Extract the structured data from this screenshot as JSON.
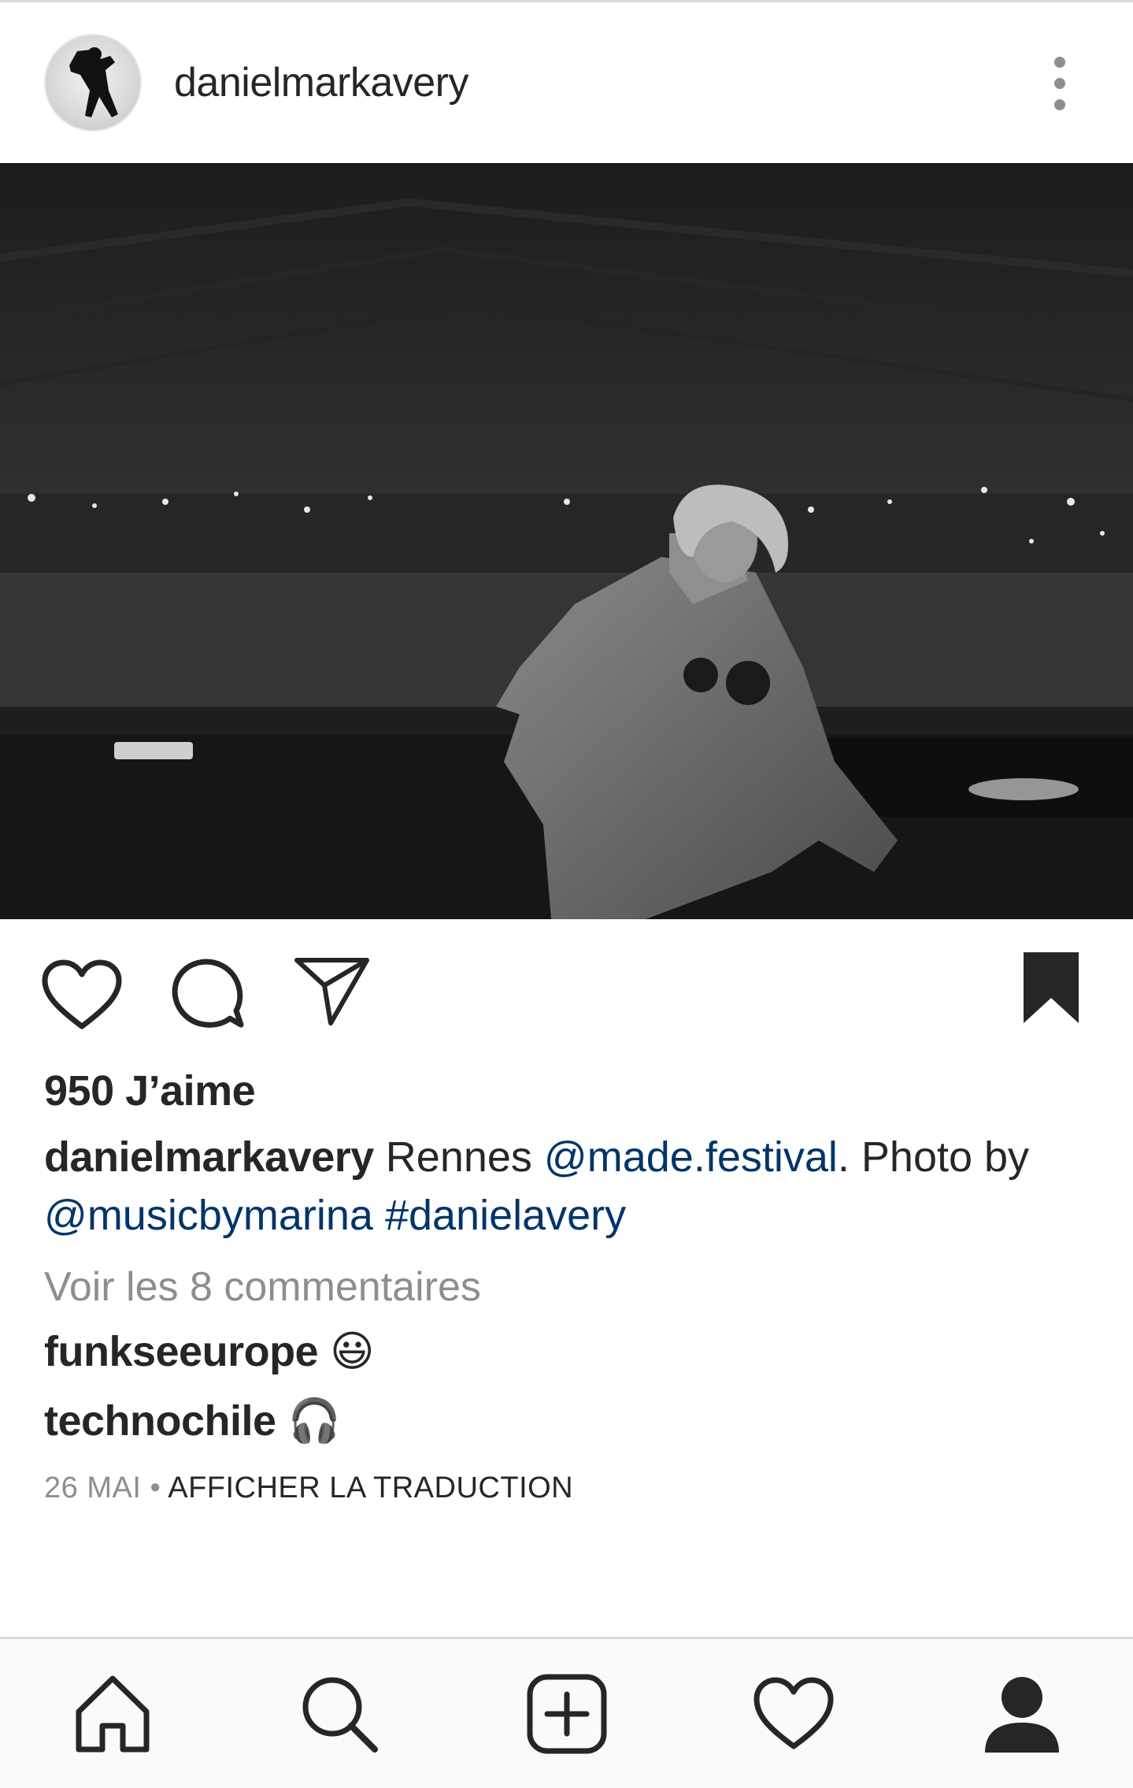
{
  "post": {
    "username": "danielmarkavery",
    "likes": "950 J’aime",
    "caption": {
      "username": "danielmarkavery",
      "text_before": " Rennes ",
      "mention1": "@made.festival",
      "text_middle": ". Photo by ",
      "mention2": "@musicbymarina",
      "space": " ",
      "hashtag": "#danielavery"
    },
    "view_comments": "Voir les 8 commentaires",
    "comments": [
      {
        "username": "funkseeurope",
        "text": " 😃"
      },
      {
        "username": "technochile",
        "text": " 🎧"
      }
    ],
    "date": "26 MAI",
    "separator": " • ",
    "translate": "AFFICHER LA TRADUCTION"
  },
  "icons": {
    "more": "more-vertical-icon",
    "like": "heart-icon",
    "comment": "comment-icon",
    "share": "send-icon",
    "save": "bookmark-filled-icon"
  },
  "nav": {
    "items": [
      "home-icon",
      "search-icon",
      "add-post-icon",
      "activity-heart-icon",
      "profile-icon"
    ]
  },
  "colors": {
    "text": "#262626",
    "link": "#003569",
    "secondary": "#8e8e8e"
  }
}
